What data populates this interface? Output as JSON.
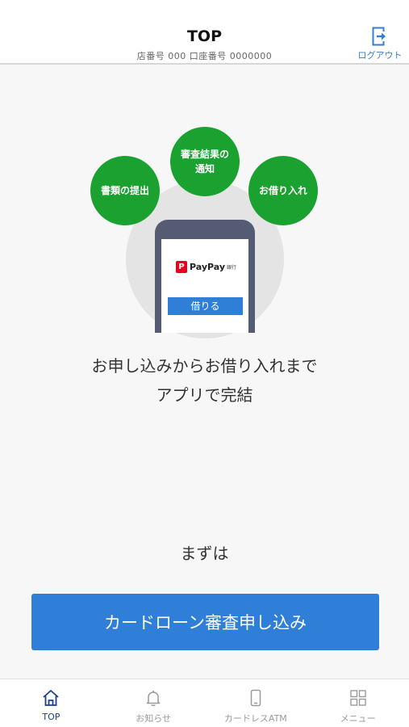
{
  "header": {
    "title": "TOP",
    "account_info": "店番号 000 口座番号 0000000",
    "logout_label": "ログアウト",
    "logout_icon": "logout-icon"
  },
  "illustration": {
    "bubbles": [
      {
        "label": "書類の提出"
      },
      {
        "label": "審査結果の\n通知"
      },
      {
        "label": "お借り入れ"
      }
    ],
    "phone": {
      "logo_mark": "P",
      "logo_text": "PayPay",
      "logo_bank": "銀行",
      "button_label": "借りる"
    }
  },
  "main": {
    "tagline_line1": "お申し込みからお借り入れまで",
    "tagline_line2": "アプリで完結",
    "lead_text": "まずは",
    "apply_button": "カードローン審査申し込み"
  },
  "tabbar": {
    "items": [
      {
        "label": "TOP",
        "icon": "home-icon",
        "active": true
      },
      {
        "label": "お知らせ",
        "icon": "bell-icon",
        "active": false
      },
      {
        "label": "カードレスATM",
        "icon": "smartphone-icon",
        "active": false
      },
      {
        "label": "メニュー",
        "icon": "grid-icon",
        "active": false
      }
    ]
  },
  "colors": {
    "accent_blue": "#2f7ed8",
    "green": "#1aa130",
    "tab_active": "#1b3f8a",
    "tab_inactive": "#9a9a9a",
    "paypay_red": "#e6001f"
  }
}
